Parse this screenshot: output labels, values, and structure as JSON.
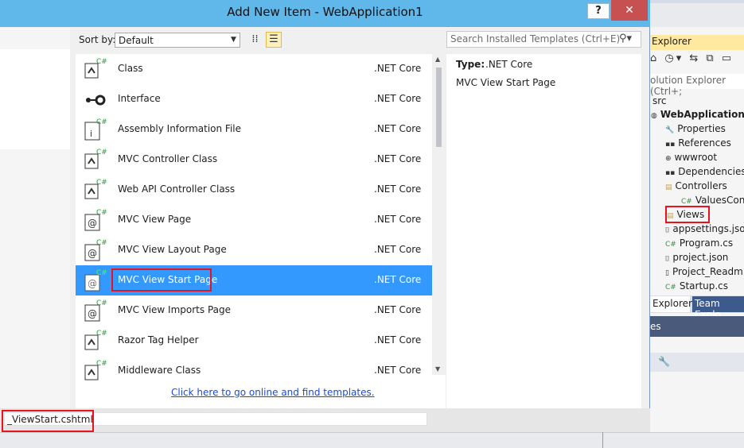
{
  "dialog": {
    "title": "Add New Item - WebApplication1",
    "help_label": "?",
    "close_label": "✕"
  },
  "toolbar": {
    "sort_label": "Sort by:",
    "sort_value": "Default",
    "search_placeholder": "Search Installed Templates (Ctrl+E)"
  },
  "templates": [
    {
      "name": "Class",
      "category": ".NET Core",
      "icon": "class-template-icon"
    },
    {
      "name": "Interface",
      "category": ".NET Core",
      "icon": "interface-template-icon"
    },
    {
      "name": "Assembly Information File",
      "category": ".NET Core",
      "icon": "assembly-info-template-icon"
    },
    {
      "name": "MVC Controller Class",
      "category": ".NET Core",
      "icon": "controller-template-icon"
    },
    {
      "name": "Web API Controller Class",
      "category": ".NET Core",
      "icon": "controller-template-icon"
    },
    {
      "name": "MVC View Page",
      "category": ".NET Core",
      "icon": "razor-page-template-icon"
    },
    {
      "name": "MVC View Layout Page",
      "category": ".NET Core",
      "icon": "razor-page-template-icon"
    },
    {
      "name": "MVC View Start Page",
      "category": ".NET Core",
      "icon": "razor-page-template-icon",
      "selected": true
    },
    {
      "name": "MVC View Imports Page",
      "category": ".NET Core",
      "icon": "razor-page-template-icon"
    },
    {
      "name": "Razor Tag Helper",
      "category": ".NET Core",
      "icon": "class-template-icon"
    },
    {
      "name": "Middleware Class",
      "category": ".NET Core",
      "icon": "class-template-icon"
    }
  ],
  "online_link": "Click here to go online and find templates.",
  "details": {
    "type_label": "Type:",
    "type_value": ".NET Core",
    "description": "MVC View Start Page"
  },
  "name_field": {
    "value": "_ViewStart.cshtml"
  },
  "solution_explorer": {
    "title": "Explorer",
    "search_placeholder": "olution Explorer (Ctrl+;",
    "items": [
      {
        "label": "src",
        "icon": ""
      },
      {
        "label": "WebApplication1",
        "icon": "web-project-icon"
      },
      {
        "label": "Properties",
        "icon": "wrench-icon"
      },
      {
        "label": "References",
        "icon": "references-icon"
      },
      {
        "label": "wwwroot",
        "icon": "globe-icon"
      },
      {
        "label": "Dependencies",
        "icon": "references-icon"
      },
      {
        "label": "Controllers",
        "icon": "folder-icon"
      },
      {
        "label": "ValuesContr",
        "icon": "csharp-file-icon"
      },
      {
        "label": "Views",
        "icon": "folder-icon"
      },
      {
        "label": "appsettings.jso",
        "icon": "json-file-icon"
      },
      {
        "label": "Program.cs",
        "icon": "csharp-file-icon"
      },
      {
        "label": "project.json",
        "icon": "json-file-icon"
      },
      {
        "label": "Project_Readm",
        "icon": "file-icon"
      },
      {
        "label": "Startup.cs",
        "icon": "csharp-file-icon"
      }
    ],
    "tabs": [
      "Explorer",
      "Team Explo"
    ],
    "properties_title": "es"
  },
  "colors": {
    "titlebar": "#5fb7ea",
    "selection": "#3399ff",
    "highlight_box": "#e8131e",
    "link": "#1a4bd8"
  }
}
